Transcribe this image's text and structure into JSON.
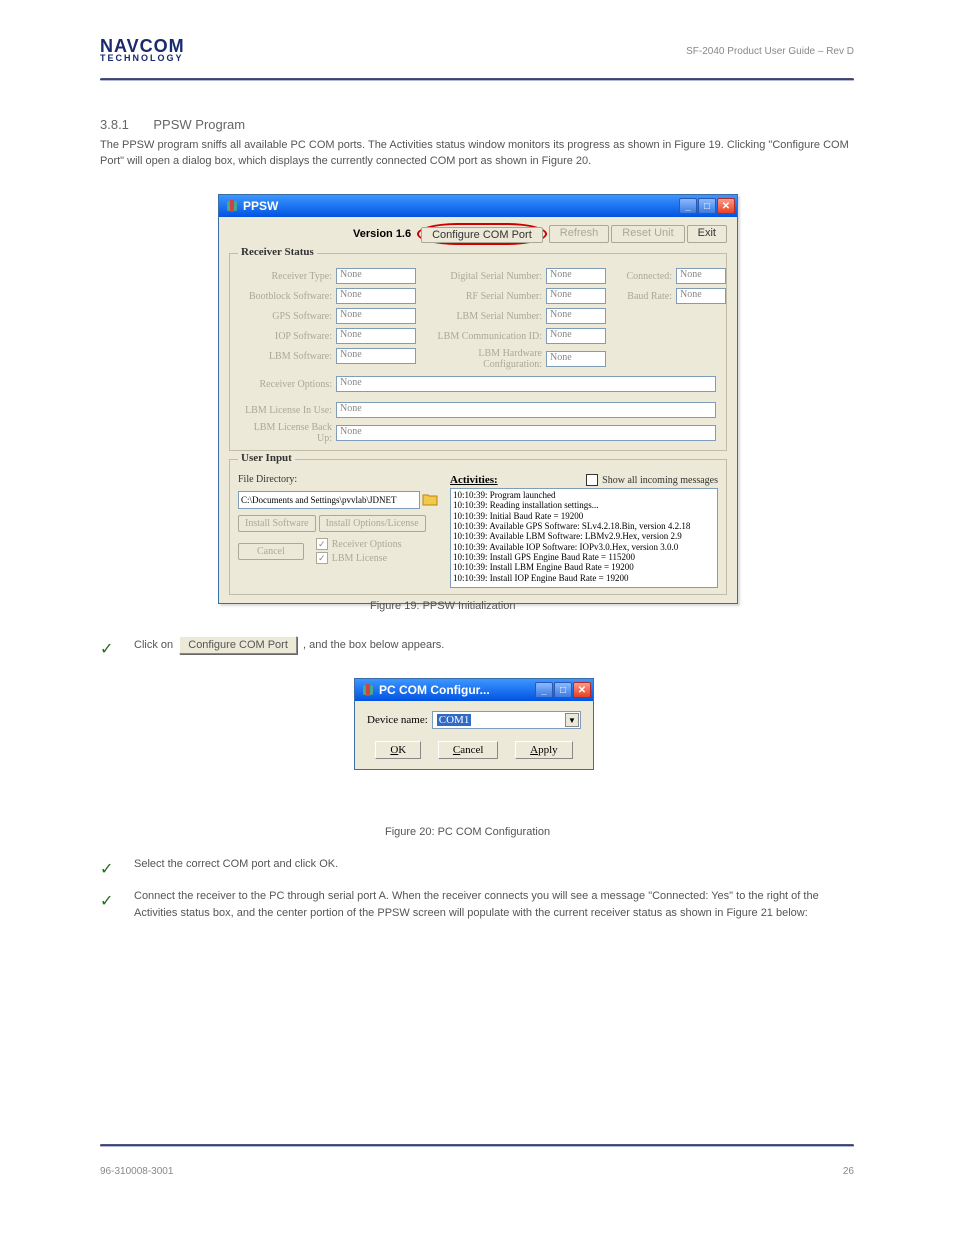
{
  "header": {
    "brand_top": "NAVCOM",
    "brand_sub": "TECHNOLOGY",
    "doc_title": "SF-2040 Product User Guide – Rev D"
  },
  "heading": {
    "num": "3.8.1",
    "title": "PPSW Program"
  },
  "intro": "The PPSW program sniffs all available PC COM ports. The Activities status window monitors its progress as shown in Figure 19. Clicking \"Configure COM Port\" will open a dialog box, which displays the currently connected COM port as shown in Figure 20.",
  "main_window": {
    "title": "PPSW",
    "version_label": "Version 1.6",
    "buttons": {
      "configure": "Configure COM Port",
      "refresh": "Refresh",
      "reset": "Reset Unit",
      "exit": "Exit"
    },
    "receiver_group": {
      "legend": "Receiver Status",
      "labels": {
        "receiver_type": "Receiver Type:",
        "bootblock": "Bootblock Software:",
        "gps": "GPS Software:",
        "iop": "IOP Software:",
        "lbm": "LBM Software:",
        "options": "Receiver Options:",
        "lic_in_use": "LBM License In Use:",
        "lic_backup": "LBM License Back Up:",
        "digital_sn": "Digital Serial Number:",
        "rf_sn": "RF Serial Number:",
        "lbm_sn": "LBM Serial Number:",
        "lbm_comm": "LBM Communication ID:",
        "lbm_hw": "LBM Hardware Configuration:",
        "connected": "Connected:",
        "baud": "Baud Rate:"
      },
      "value_none": "None"
    },
    "user_input": {
      "legend": "User Input",
      "file_dir_label": "File Directory:",
      "file_dir_value": "C:\\Documents and Settings\\pvvlab\\JDNET",
      "install_sw": "Install Software",
      "install_opt": "Install Options/License",
      "cancel": "Cancel",
      "chk_recv_opt": "Receiver Options",
      "chk_lbm_lic": "LBM License"
    },
    "activities": {
      "title": "Activities:",
      "show_all_label": "Show all incoming messages",
      "log": [
        "10:10:39: Program launched",
        "10:10:39: Reading installation settings...",
        "10:10:39: Initial Baud Rate = 19200",
        "10:10:39: Available GPS Software: SLv4.2.18.Bin, version 4.2.18",
        "10:10:39: Available LBM Software: LBMv2.9.Hex, version 2.9",
        "10:10:39: Available IOP Software: IOPv3.0.Hex, version 3.0.0",
        "10:10:39: Install GPS Engine Baud Rate = 115200",
        "10:10:39: Install LBM Engine Baud Rate = 19200",
        "10:10:39: Install IOP Engine Baud Rate = 19200"
      ]
    }
  },
  "fig19": "Figure 19:  PPSW Initialization",
  "step1_prefix": "Click on",
  "step1_btn": "Configure COM Port",
  "step1_suffix": ", and the box below appears.",
  "dlg": {
    "title": "PC COM Configur...",
    "device_label": "Device name:",
    "device_value": "COM1",
    "ok": "OK",
    "cancel": "Cancel",
    "apply": "Apply"
  },
  "fig20": "Figure 20:  PC COM Configuration",
  "step2": "Select the correct COM port and click OK.",
  "step3": "Connect the receiver to the PC through serial port A. When the receiver connects you will see a message \"Connected: Yes\" to the right of the Activities status box, and the center portion of the PPSW screen will populate with the current receiver status as shown in Figure 21 below:",
  "footer": {
    "pub": "96-310008-3001",
    "page": "26"
  }
}
